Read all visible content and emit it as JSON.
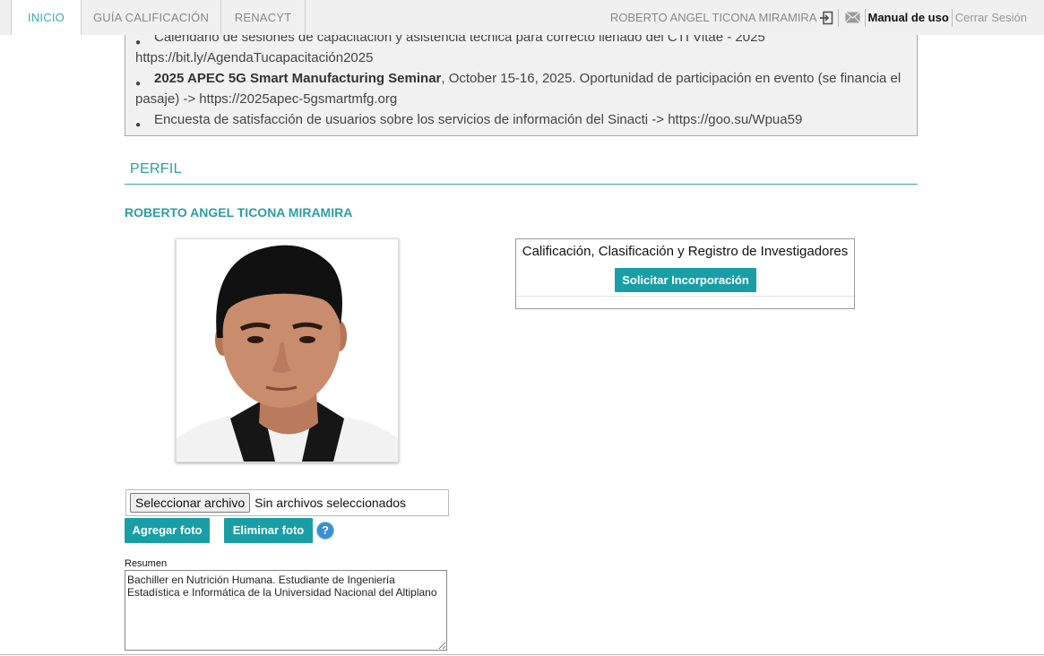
{
  "nav": {
    "tabs": [
      {
        "label": "INICIO",
        "active": true
      },
      {
        "label": "GUÍA CALIFICACIÓN",
        "active": false
      },
      {
        "label": "RENACYT",
        "active": false
      }
    ],
    "user_name": "ROBERTO ANGEL TICONA MIRAMIRA",
    "manual_label": "Manual de uso",
    "logout_label": "Cerrar Sesión"
  },
  "notice": {
    "item1_line1": "Calendario de sesiones de capacitación y asistencia técnica para correcto llenado del CTI Vitae - 2025",
    "item1_line2": "https://bit.ly/AgendaTucapacitación2025",
    "item2_bold": "2025 APEC 5G Smart Manufacturing Seminar",
    "item2_rest": ", October 15-16, 2025. Oportunidad de participación en evento (se financia el",
    "item2_line2": "pasaje) -> https://2025apec-5gsmartmfg.org",
    "item3": "Encuesta de satisfacción de usuarios sobre los servicios de información del Sinacti -> https://goo.su/Wpua59"
  },
  "profile": {
    "section_title": "PERFIL",
    "name": "ROBERTO ANGEL TICONA MIRAMIRA",
    "calif_title": "Calificación, Clasificación y Registro de Investigadores",
    "calif_button": "Solicitar Incorporación",
    "file_button": "Seleccionar archivo",
    "file_status": "Sin archivos seleccionados",
    "add_photo": "Agregar foto",
    "remove_photo": "Eliminar foto",
    "help_symbol": "?",
    "resumen_label": "Resumen",
    "resumen_text": "Bachiller en Nutrición Humana. Estudiante de Ingeniería Estadística e Informática de la Universidad Nacional del Altiplano"
  },
  "colors": {
    "accent": "#1a9ea6",
    "nav_bg": "#f0f0f0",
    "notice_bg": "#f1f1f1"
  }
}
